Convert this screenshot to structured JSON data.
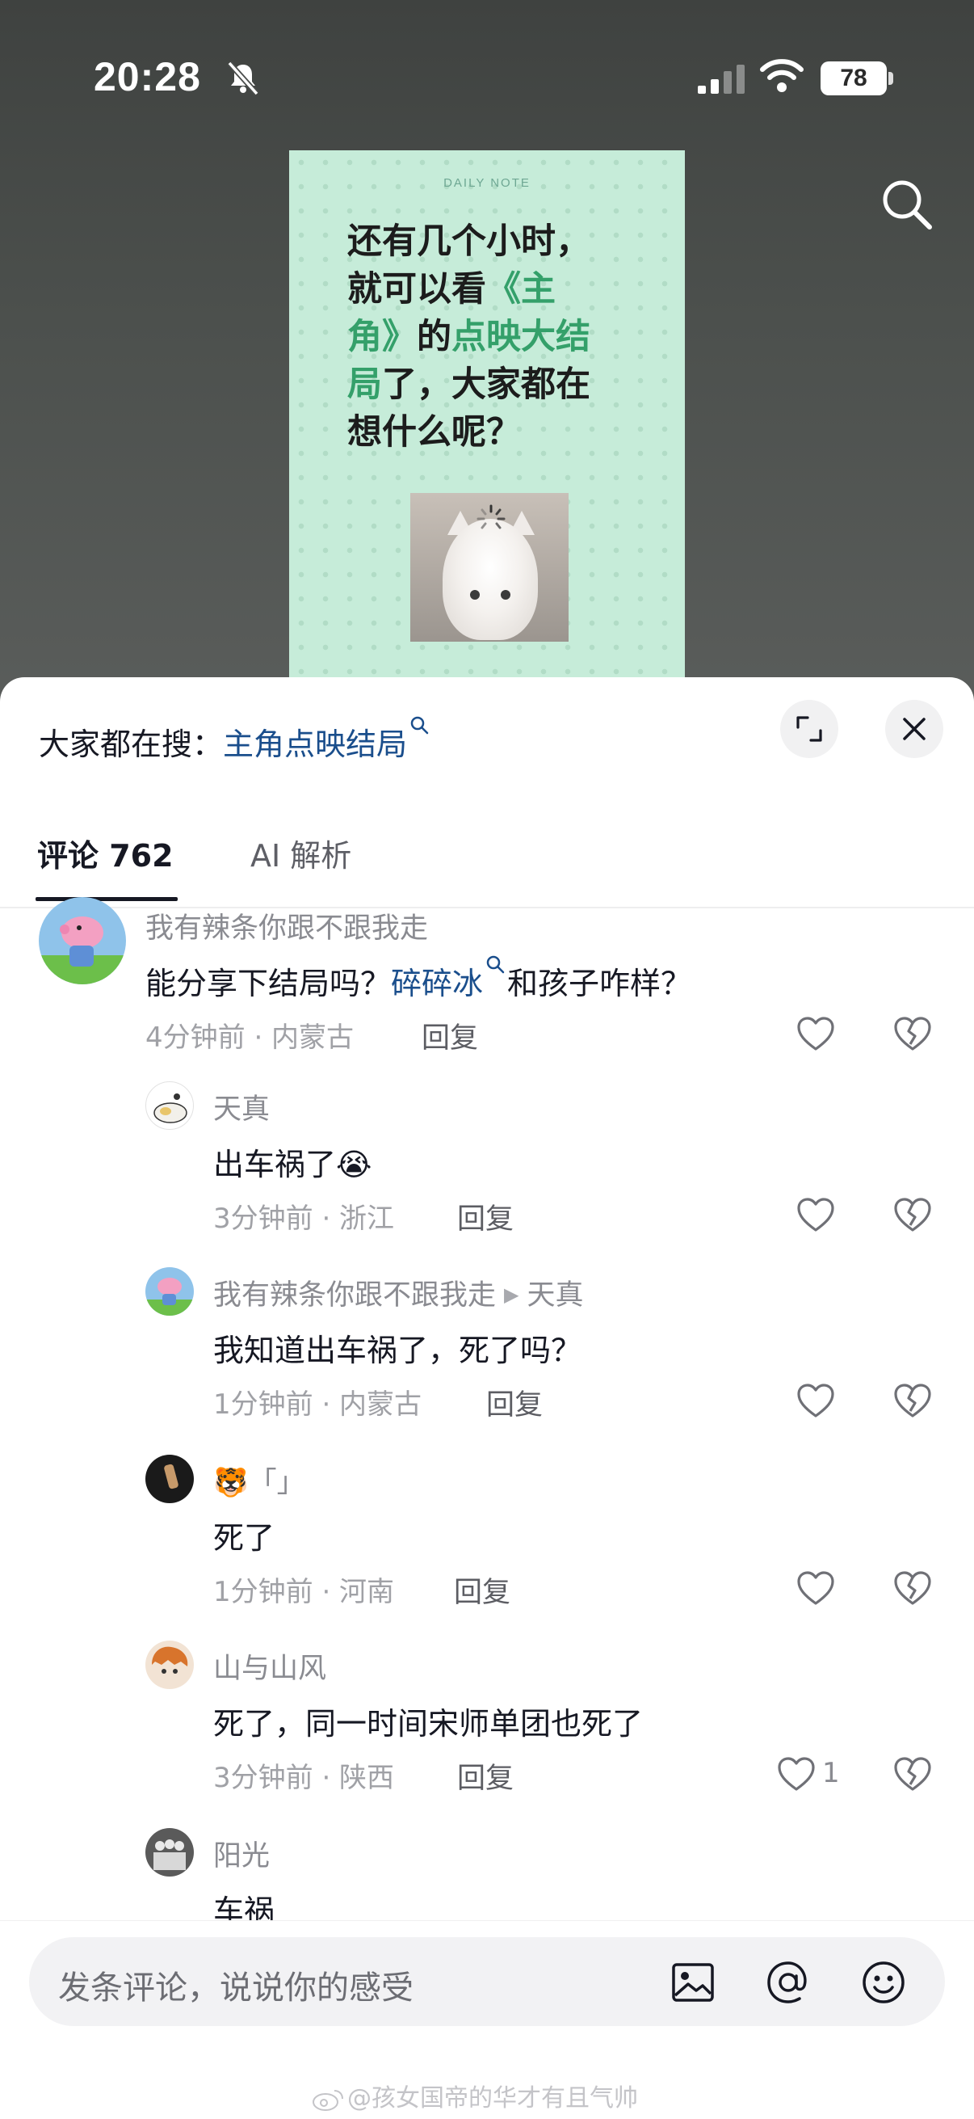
{
  "status_bar": {
    "time": "20:28",
    "battery": "78"
  },
  "note_card": {
    "tag": "DAILY NOTE",
    "line1": "还有几个小时，",
    "line2_a": "就可以看",
    "line2_b": "《主",
    "line3_a": "角》",
    "line3_b": "的",
    "line3_c": "点映大结",
    "line4_a": "局",
    "line4_b": "了，大家都在",
    "line5": "想什么呢？"
  },
  "hot_search": {
    "prefix": "大家都在搜：",
    "query": "主角点映结局"
  },
  "tabs": {
    "comments": "评论 762",
    "ai": "AI 解析"
  },
  "comments": [
    {
      "user": "我有辣条你跟不跟我走",
      "text_a": "能分享下结局吗？",
      "text_link": "碎碎冰",
      "text_b": "和孩子咋样？",
      "meta": "4分钟前 · 内蒙古",
      "reply": "回复"
    },
    {
      "user": "天真",
      "text": "出车祸了😭",
      "meta": "3分钟前 · 浙江",
      "reply": "回复"
    },
    {
      "user": "我有辣条你跟不跟我走",
      "reply_to": "天真",
      "text": "我知道出车祸了，死了吗？",
      "meta": "1分钟前 · 内蒙古",
      "reply": "回复"
    },
    {
      "user": "🐯「」",
      "text": "死了",
      "meta": "1分钟前 · 河南",
      "reply": "回复"
    },
    {
      "user": "山与山风",
      "text": "死了，同一时间宋师单团也死了",
      "meta": "3分钟前 · 陕西",
      "reply": "回复",
      "likes": "1"
    },
    {
      "user": "阳光",
      "text": "车祸"
    }
  ],
  "input": {
    "placeholder": "发条评论，说说你的感受"
  },
  "watermark": "@孩女国帝的华才有且气帅"
}
